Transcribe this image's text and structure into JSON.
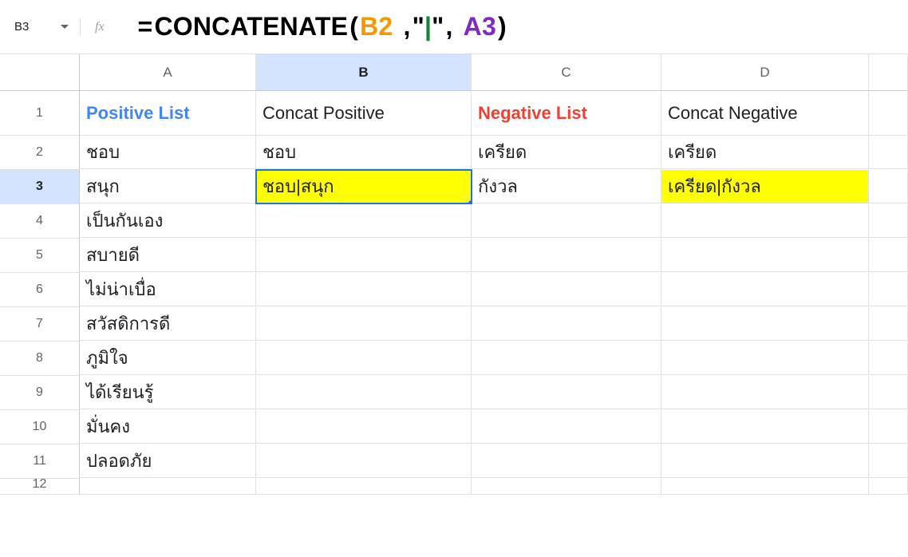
{
  "nameBox": "B3",
  "formula": {
    "fn": "CONCATENATE",
    "argB": "B2",
    "pipe": "\"|\"",
    "argA": "A3"
  },
  "columns": [
    "",
    "A",
    "B",
    "C",
    "D",
    ""
  ],
  "rows": [
    {
      "n": "1",
      "A": "Positive List",
      "B": "Concat Positive",
      "C": "Negative List",
      "D": "Concat Negative"
    },
    {
      "n": "2",
      "A": "ชอบ",
      "B": "ชอบ",
      "C": "เครียด",
      "D": "เครียด"
    },
    {
      "n": "3",
      "A": "สนุก",
      "B": "ชอบ|สนุก",
      "C": "กังวล",
      "D": "เครียด|กังวล"
    },
    {
      "n": "4",
      "A": "เป็นกันเอง",
      "B": "",
      "C": "",
      "D": ""
    },
    {
      "n": "5",
      "A": "สบายดี",
      "B": "",
      "C": "",
      "D": ""
    },
    {
      "n": "6",
      "A": "ไม่น่าเบื่อ",
      "B": "",
      "C": "",
      "D": ""
    },
    {
      "n": "7",
      "A": "สวัสดิการดี",
      "B": "",
      "C": "",
      "D": ""
    },
    {
      "n": "8",
      "A": "ภูมิใจ",
      "B": "",
      "C": "",
      "D": ""
    },
    {
      "n": "9",
      "A": "ได้เรียนรู้",
      "B": "",
      "C": "",
      "D": ""
    },
    {
      "n": "10",
      "A": "มั่นคง",
      "B": "",
      "C": "",
      "D": ""
    },
    {
      "n": "11",
      "A": "ปลอดภัย",
      "B": "",
      "C": "",
      "D": ""
    },
    {
      "n": "12",
      "A": "",
      "B": "",
      "C": "",
      "D": ""
    }
  ],
  "activeCell": "B3",
  "highlightedCells": [
    "B3",
    "D3"
  ],
  "selectedColumn": "B",
  "selectedRow": "3"
}
